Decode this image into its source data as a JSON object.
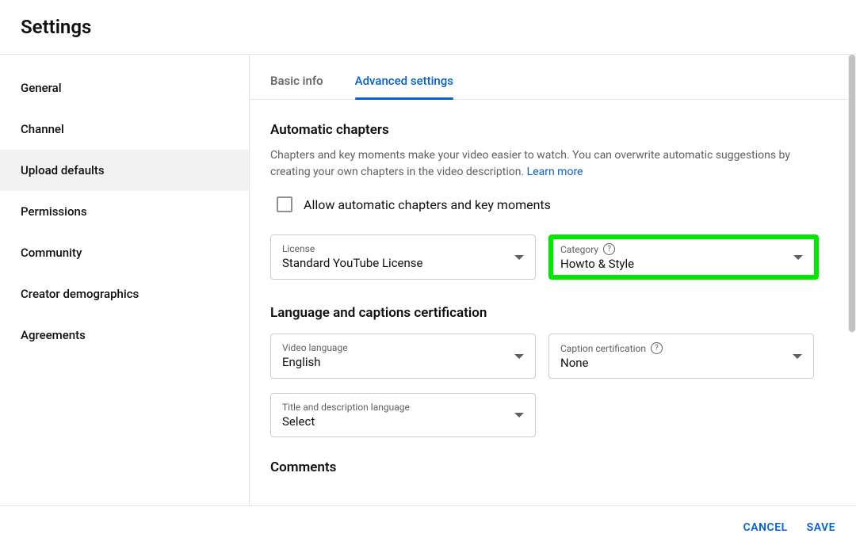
{
  "header": {
    "title": "Settings"
  },
  "sidebar": {
    "items": [
      {
        "label": "General"
      },
      {
        "label": "Channel"
      },
      {
        "label": "Upload defaults"
      },
      {
        "label": "Permissions"
      },
      {
        "label": "Community"
      },
      {
        "label": "Creator demographics"
      },
      {
        "label": "Agreements"
      }
    ]
  },
  "tabs": {
    "basic": "Basic info",
    "advanced": "Advanced settings"
  },
  "sections": {
    "auto_chapters": {
      "title": "Automatic chapters",
      "desc": "Chapters and key moments make your video easier to watch. You can overwrite automatic suggestions by creating your own chapters in the video description. ",
      "learn_more": "Learn more",
      "checkbox_label": "Allow automatic chapters and key moments"
    },
    "license": {
      "label": "License",
      "value": "Standard YouTube License"
    },
    "category": {
      "label": "Category",
      "value": "Howto & Style"
    },
    "lang_section_title": "Language and captions certification",
    "video_language": {
      "label": "Video language",
      "value": "English"
    },
    "caption_cert": {
      "label": "Caption certification",
      "value": "None"
    },
    "title_desc_lang": {
      "label": "Title and description language",
      "value": "Select"
    },
    "comments_title": "Comments"
  },
  "footer": {
    "cancel": "CANCEL",
    "save": "SAVE"
  }
}
